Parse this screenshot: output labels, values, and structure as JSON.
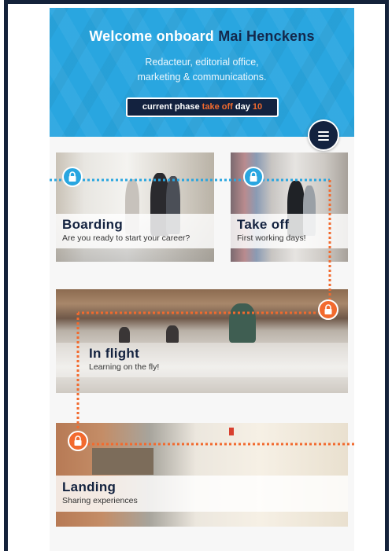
{
  "header": {
    "welcome_prefix": "Welcome onboard",
    "user_name": "Mai Henckens",
    "role_line1": "Redacteur, editorial office,",
    "role_line2": "marketing & communications.",
    "phase_prefix": "current phase",
    "phase_name": "take off",
    "day_label": "day",
    "day_number": "10"
  },
  "menu": {
    "icon": "hamburger-menu-icon"
  },
  "phases": [
    {
      "title": "Boarding",
      "subtitle": "Are you ready to start your career?",
      "lock_icon": "lock-icon",
      "status_color": "#29a6e0"
    },
    {
      "title": "Take off",
      "subtitle": "First working days!",
      "lock_icon": "lock-icon",
      "status_color": "#29a6e0"
    },
    {
      "title": "In flight",
      "subtitle": "Learning on the fly!",
      "lock_icon": "lock-icon",
      "status_color": "#f26a2e"
    },
    {
      "title": "Landing",
      "subtitle": "Sharing experiences",
      "lock_icon": "lock-icon",
      "status_color": "#f26a2e"
    }
  ],
  "colors": {
    "brand_blue": "#29a6e0",
    "navy": "#13223f",
    "accent_orange": "#f26a2e",
    "frame": "#14223a"
  }
}
